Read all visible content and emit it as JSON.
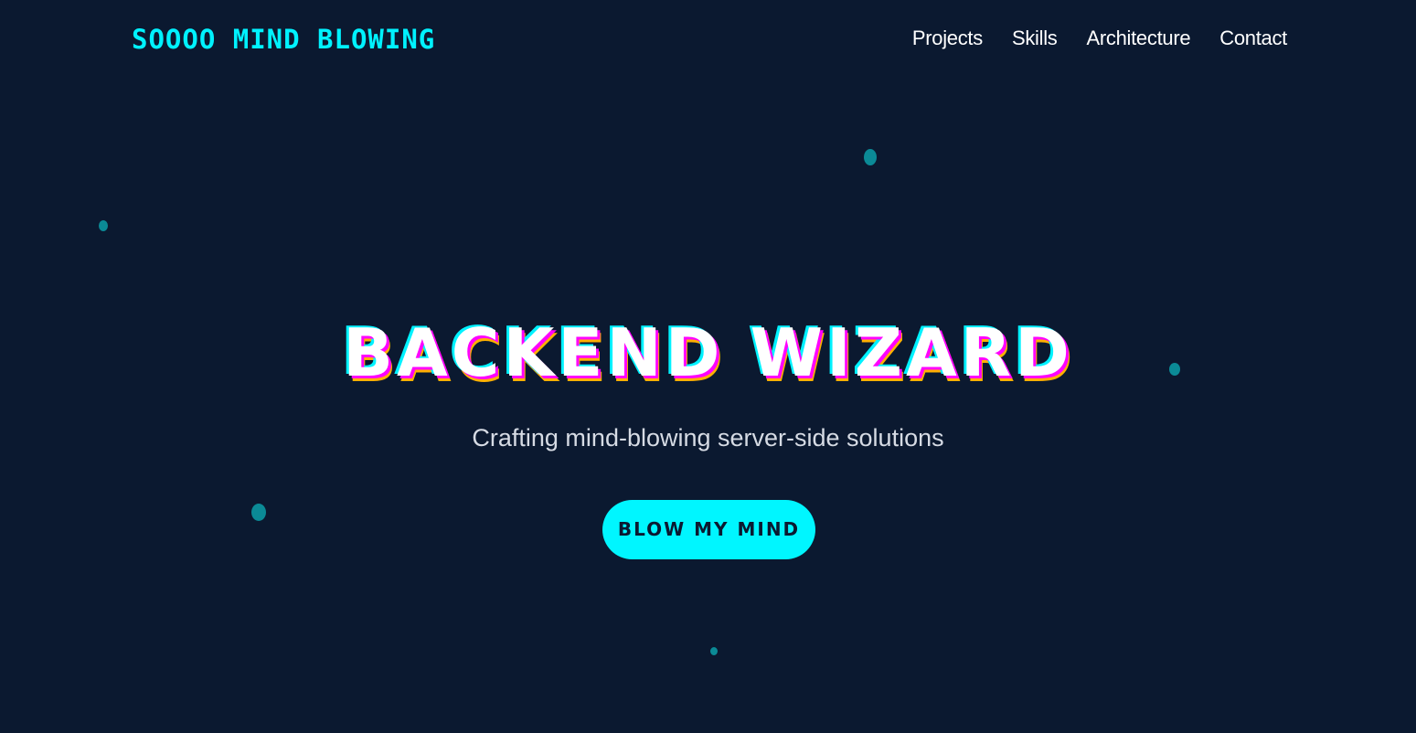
{
  "header": {
    "logo": "SOOOO MIND BLOWING",
    "nav": [
      {
        "label": "Projects"
      },
      {
        "label": "Skills"
      },
      {
        "label": "Architecture"
      },
      {
        "label": "Contact"
      }
    ]
  },
  "hero": {
    "title": "BACKEND WIZARD",
    "subtitle": "Crafting mind-blowing server-side solutions",
    "cta_label": "BLOW MY MIND"
  },
  "colors": {
    "background": "#0b1930",
    "accent": "#00f2ff",
    "particle": "#0b8a96",
    "glitch_magenta": "#ff00ff",
    "glitch_orange": "#ffb000"
  }
}
